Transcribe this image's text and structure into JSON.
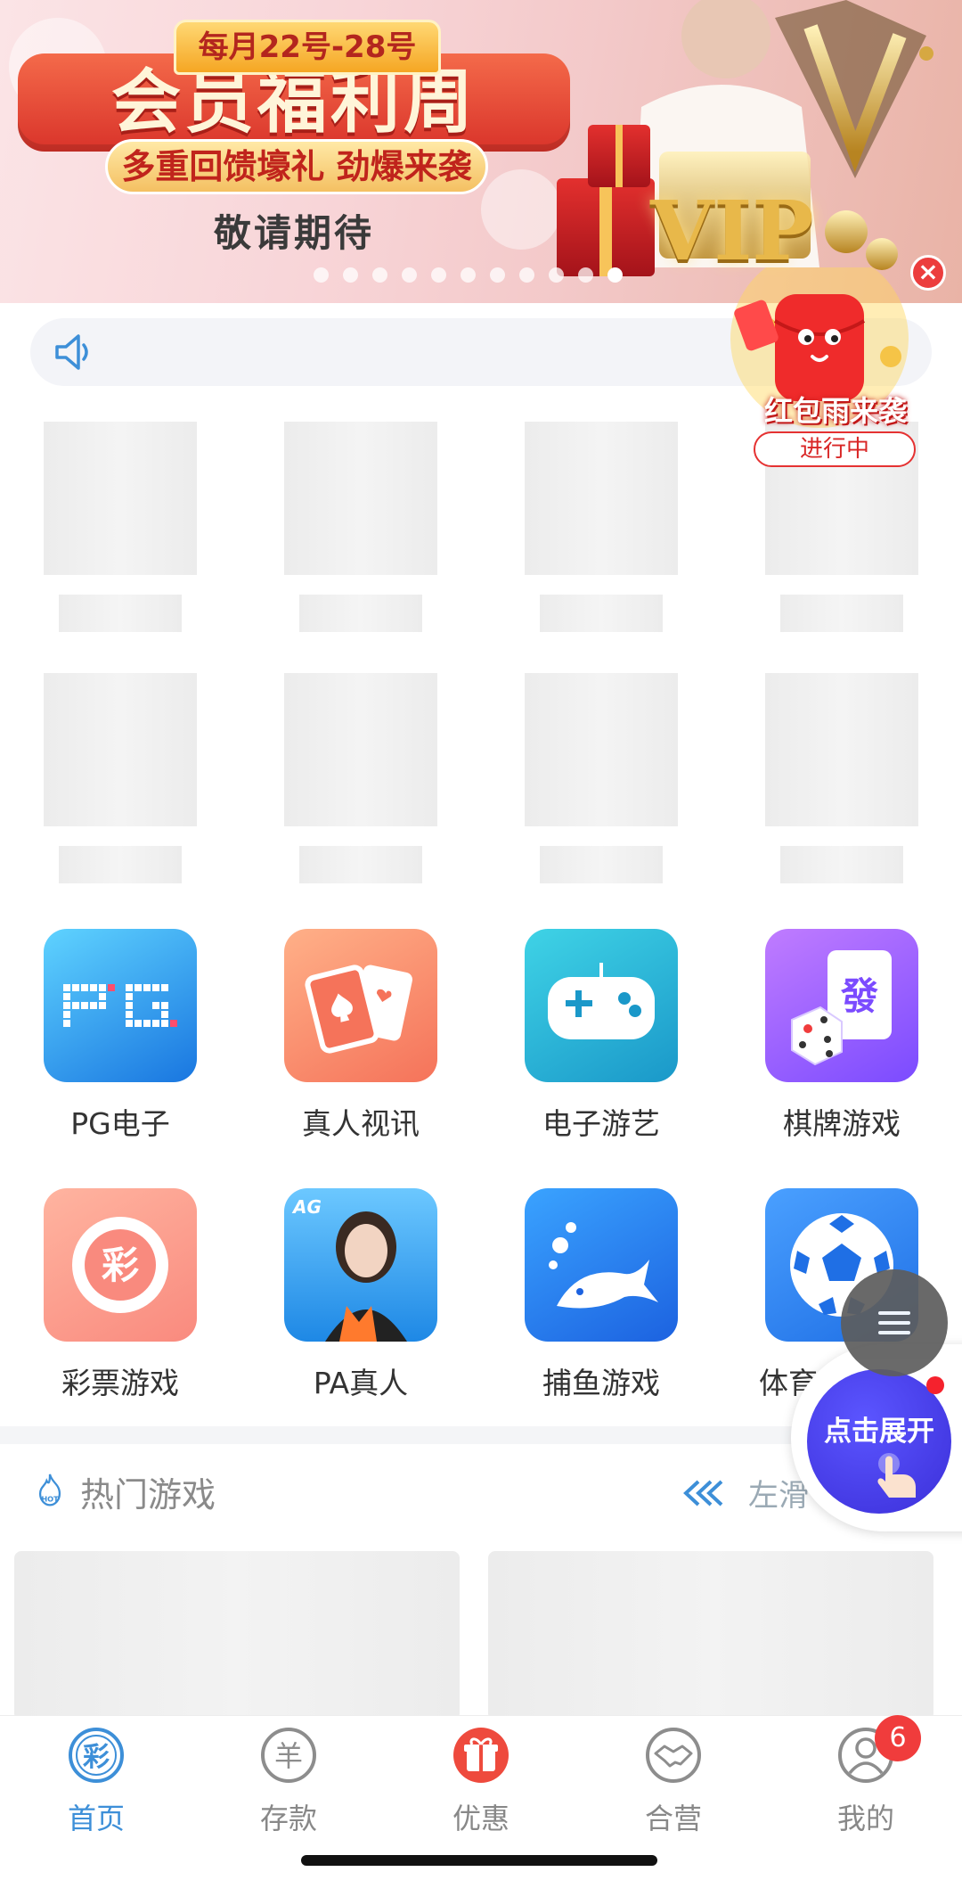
{
  "banner": {
    "date_ribbon": "每月22号-28号",
    "title": "会员福利周",
    "subtitle": "多重回馈壕礼 劲爆来袭",
    "tagline": "敬请期待",
    "vip_text": "VIP",
    "slide_count": 11,
    "active_slide": 11
  },
  "notice": {
    "icon": "speaker-icon",
    "text": ""
  },
  "red_packet": {
    "title": "红包雨来袭",
    "status": "进行中",
    "close_icon": "close-icon"
  },
  "categories": [
    {
      "label": "PG电子",
      "icon": "pg-logo-icon"
    },
    {
      "label": "真人视讯",
      "icon": "playing-cards-icon"
    },
    {
      "label": "电子游艺",
      "icon": "gamepad-icon"
    },
    {
      "label": "棋牌游戏",
      "icon": "mahjong-dice-icon"
    },
    {
      "label": "彩票游戏",
      "icon": "lottery-ball-icon"
    },
    {
      "label": "PA真人",
      "icon": "pa-live-dealer-icon"
    },
    {
      "label": "捕鱼游戏",
      "icon": "fish-icon"
    },
    {
      "label": "体育",
      "icon": "soccer-ball-icon"
    }
  ],
  "pa_badge": "AG",
  "lottery_char": "彩",
  "mahjong_char": "發",
  "hot_games": {
    "title": "热门游戏",
    "swipe_hint": "左滑"
  },
  "floating": {
    "menu_icon": "menu-icon",
    "expand_label": "点击展开"
  },
  "tabbar": {
    "items": [
      {
        "label": "首页",
        "icon": "lottery-home-icon",
        "active": true
      },
      {
        "label": "存款",
        "icon": "yang-coin-icon",
        "active": false
      },
      {
        "label": "优惠",
        "icon": "gift-box-icon",
        "active": false
      },
      {
        "label": "合营",
        "icon": "handshake-icon",
        "active": false
      },
      {
        "label": "我的",
        "icon": "user-icon",
        "active": false
      }
    ],
    "home_char": "彩",
    "deposit_char": "羊",
    "mine_badge": "6"
  },
  "colors": {
    "accent": "#3d8fd8",
    "badge": "#f03c3c",
    "banner_red": "#d9332a"
  }
}
